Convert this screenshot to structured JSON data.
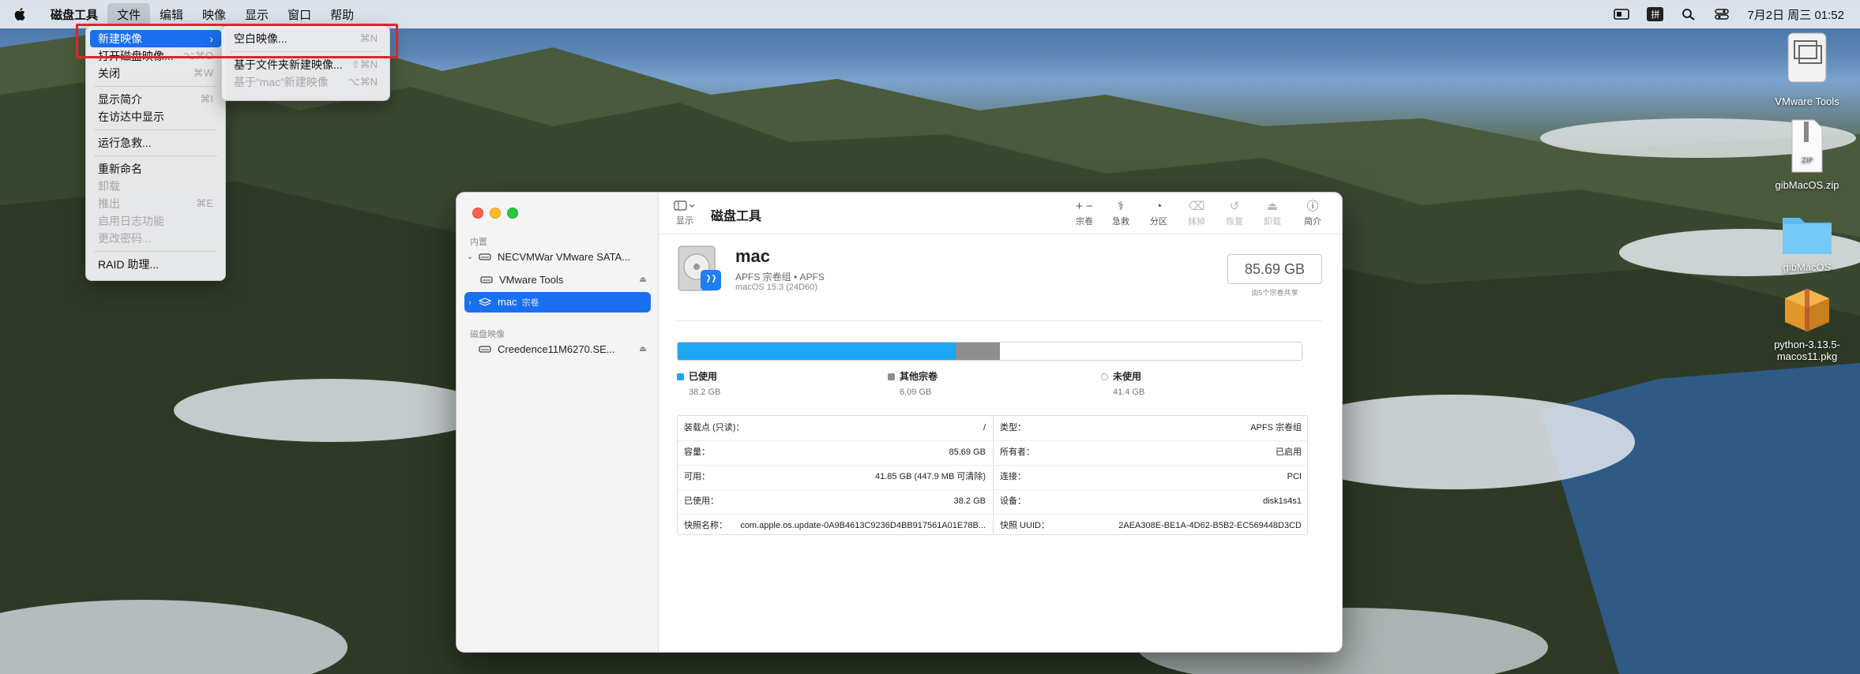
{
  "menubar": {
    "app": "磁盘工具",
    "items": [
      "文件",
      "编辑",
      "映像",
      "显示",
      "窗口",
      "帮助"
    ],
    "ime": "拼",
    "clock": "7月2日 周三 01:52"
  },
  "file_menu": {
    "items": [
      {
        "label": "新建映像",
        "shortcut": ""
      },
      {
        "label": "打开磁盘映像...",
        "shortcut": "⌥⌘O"
      },
      {
        "label": "关闭",
        "shortcut": "⌘W"
      },
      {
        "label": "显示简介",
        "shortcut": "⌘I"
      },
      {
        "label": "在访达中显示",
        "shortcut": ""
      },
      {
        "label": "运行急救...",
        "shortcut": ""
      },
      {
        "label": "重新命名",
        "shortcut": ""
      },
      {
        "label": "卸载",
        "shortcut": ""
      },
      {
        "label": "推出",
        "shortcut": "⌘E"
      },
      {
        "label": "启用日志功能",
        "shortcut": ""
      },
      {
        "label": "更改密码...",
        "shortcut": ""
      },
      {
        "label": "RAID 助理...",
        "shortcut": ""
      }
    ]
  },
  "sub_menu": {
    "items": [
      {
        "label": "空白映像...",
        "shortcut": "⌘N"
      },
      {
        "label": "基于文件夹新建映像...",
        "shortcut": "⇧⌘N"
      },
      {
        "label": "基于“mac”新建映像",
        "shortcut": "⌥⌘N"
      }
    ]
  },
  "desktop_icons": [
    {
      "label": "VMware Tools"
    },
    {
      "label": "gibMacOS.zip"
    },
    {
      "label": "gibMacOS"
    },
    {
      "label": "python-3.13.5-macos11.pkg"
    }
  ],
  "sidebar": {
    "internal_header": "内置",
    "disk_images_header": "磁盘映像",
    "rows": [
      {
        "label": "NECVMWar VMware SATA..."
      },
      {
        "label": "VMware Tools"
      },
      {
        "label": "mac",
        "kind": "宗卷"
      },
      {
        "label": "Creedence11M6270.SE..."
      }
    ]
  },
  "toolbar": {
    "view_label": "显示",
    "title": "磁盘工具",
    "buttons": [
      {
        "label": "宗卷",
        "glyph": "+ −"
      },
      {
        "label": "急救",
        "glyph": "⚕"
      },
      {
        "label": "分区",
        "glyph": "◔"
      },
      {
        "label": "抹掉",
        "glyph": "⌫"
      },
      {
        "label": "恢复",
        "glyph": "↺"
      },
      {
        "label": "卸载",
        "glyph": "⏏"
      },
      {
        "label": "简介",
        "glyph": "ⓘ"
      }
    ]
  },
  "volume": {
    "name": "mac",
    "subtitle": "APFS 宗卷组 • APFS",
    "os": "macOS 15.3 (24D60)",
    "capacity": "85.69 GB",
    "shared_note": "由5个宗卷共享"
  },
  "usage": {
    "total_gb": 85.69,
    "segments": [
      {
        "label": "已使用",
        "value_text": "38.2 GB",
        "value": 38.2,
        "color": "#1ea7f5"
      },
      {
        "label": "其他宗卷",
        "value_text": "6.09 GB",
        "value": 6.09,
        "color": "#8e8e8e"
      },
      {
        "label": "未使用",
        "value_text": "41.4 GB",
        "value": 41.4,
        "color": "#ffffff"
      }
    ]
  },
  "info": {
    "left": [
      {
        "k": "装载点 (只读)：",
        "v": "/"
      },
      {
        "k": "容量：",
        "v": "85.69 GB"
      },
      {
        "k": "可用：",
        "v": "41.85 GB (447.9 MB 可清除)"
      },
      {
        "k": "已使用：",
        "v": "38.2 GB"
      },
      {
        "k": "快照名称：",
        "v": "com.apple.os.update-0A9B4613C9236D4BB917561A01E78B..."
      }
    ],
    "right": [
      {
        "k": "类型：",
        "v": "APFS 宗卷组"
      },
      {
        "k": "所有者：",
        "v": "已启用"
      },
      {
        "k": "连接：",
        "v": "PCI"
      },
      {
        "k": "设备：",
        "v": "disk1s4s1"
      },
      {
        "k": "快照 UUID：",
        "v": "2AEA308E-BE1A-4D62-B5B2-EC569448D3CD"
      }
    ]
  }
}
